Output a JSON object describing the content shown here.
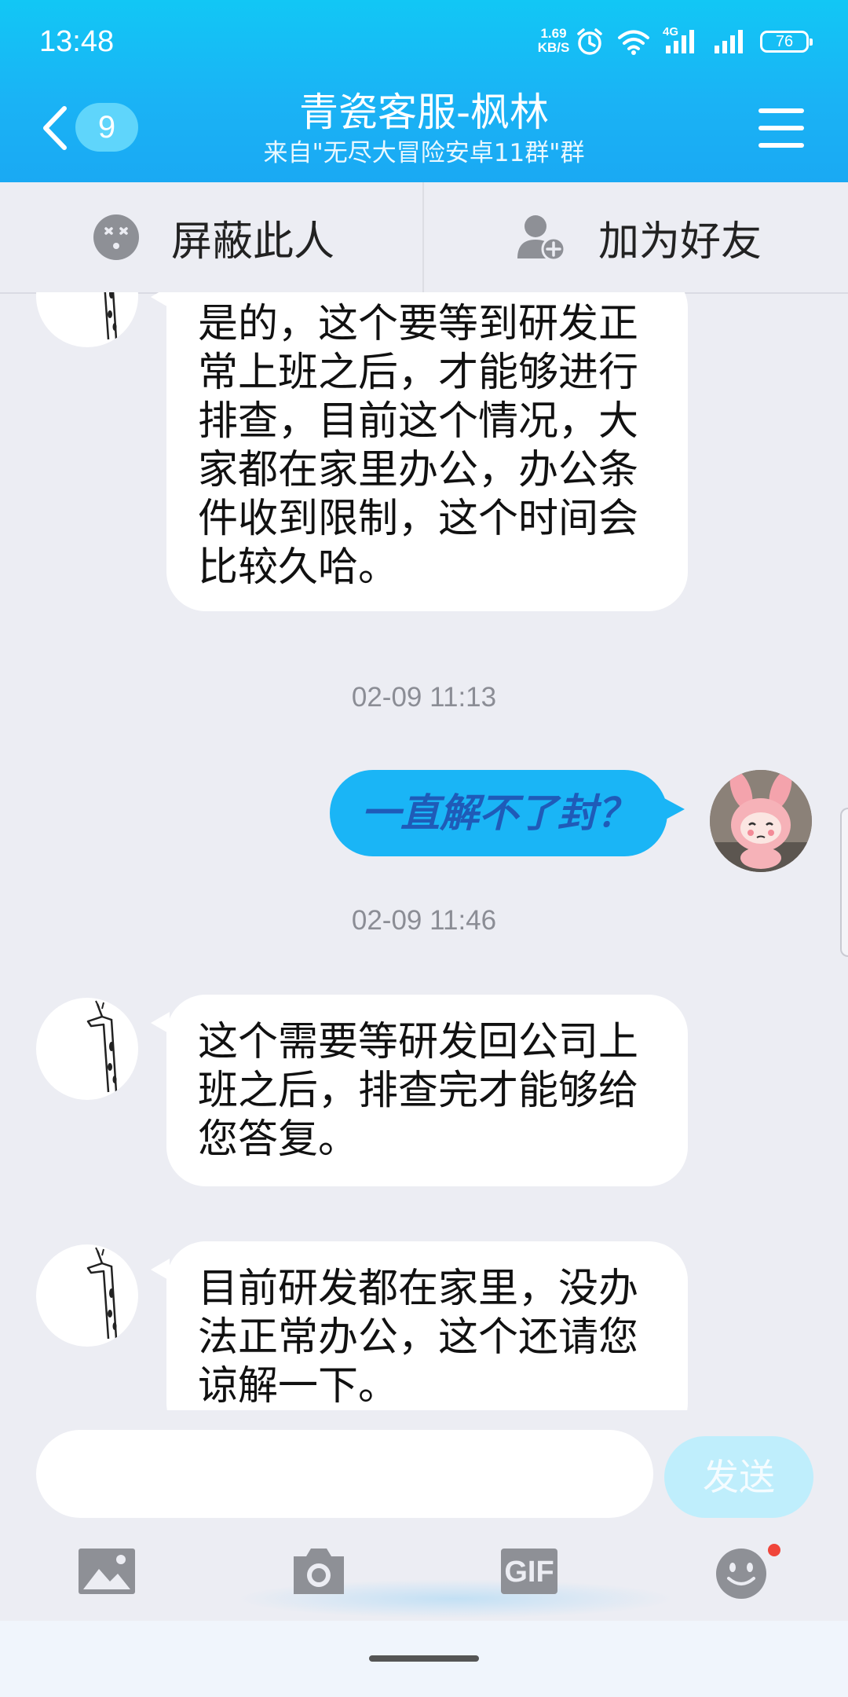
{
  "status_bar": {
    "time": "13:48",
    "net_speed_value": "1.69",
    "net_speed_unit": "KB/S",
    "network_label": "4G",
    "battery_level": "76"
  },
  "header": {
    "unread_count": "9",
    "title": "青瓷客服-枫林",
    "subtitle": "来自\"无尽大冒险安卓11群\"群"
  },
  "actions": {
    "block_label": "屏蔽此人",
    "add_friend_label": "加为好友"
  },
  "messages": [
    {
      "side": "incoming",
      "text": "是的，这个要等到研发正常上班之后，才能够进行排查，目前这个情况，大家都在家里办公，办公条件收到限制，这个时间会比较久哈。"
    },
    {
      "type": "timestamp",
      "text": "02-09 11:13"
    },
    {
      "side": "outgoing",
      "text": "一直解不了封？"
    },
    {
      "type": "timestamp",
      "text": "02-09 11:46"
    },
    {
      "side": "incoming",
      "text": "这个需要等研发回公司上班之后，排查完才能够给您答复。"
    },
    {
      "side": "incoming",
      "text": "目前研发都在家里，没办法正常办公，这个还请您谅解一下。"
    }
  ],
  "input": {
    "value": "",
    "send_label": "发送"
  },
  "toolbar": {
    "gif_label": "GIF"
  },
  "colors": {
    "header_blue": "#1ab3f5",
    "outgoing_bubble": "#1ab5f6",
    "notification_dot": "#f0453a"
  }
}
